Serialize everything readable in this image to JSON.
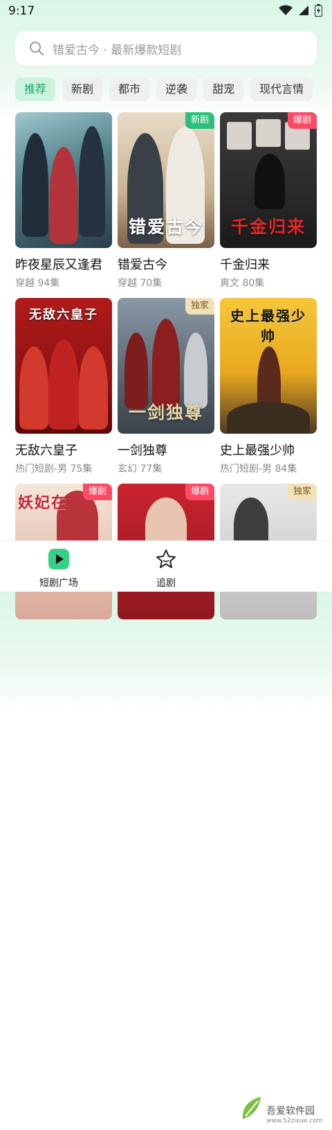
{
  "status": {
    "time": "9:17"
  },
  "search": {
    "placeholder": "错爱古今 · 最新爆款短剧"
  },
  "tags": [
    "推荐",
    "新剧",
    "都市",
    "逆袭",
    "甜宠",
    "现代言情"
  ],
  "cards": [
    {
      "title": "昨夜星辰又逢君",
      "sub": "穿越 94集",
      "badge": "",
      "poster_text": ""
    },
    {
      "title": "错爱古今",
      "sub": "穿越 70集",
      "badge": "新剧",
      "poster_text": "错爱古今"
    },
    {
      "title": "千金归来",
      "sub": "爽文 80集",
      "badge": "爆剧",
      "poster_text": "千金归来"
    },
    {
      "title": "无敌六皇子",
      "sub": "热门短剧-男 75集",
      "badge": "",
      "poster_text": "无敌六皇子"
    },
    {
      "title": "一剑独尊",
      "sub": "玄幻 77集",
      "badge": "独家",
      "poster_text": "一剑独尊"
    },
    {
      "title": "史上最强少帅",
      "sub": "热门短剧-男 84集",
      "badge": "",
      "poster_text": "史上最强少帅"
    },
    {
      "title": "",
      "sub": "",
      "badge": "爆剧",
      "poster_text": "妖妃在"
    },
    {
      "title": "",
      "sub": "",
      "badge": "爆剧",
      "poster_text": ""
    },
    {
      "title": "",
      "sub": "",
      "badge": "独家",
      "poster_text": ""
    }
  ],
  "nav": {
    "home_label": "短剧广场",
    "follow_label": "追剧"
  },
  "watermark": {
    "brand": "吾爱软件园",
    "url": "www.52zixue.com"
  },
  "colors": {
    "accent": "#16a866",
    "badge_new": "#2fbf7a",
    "badge_hot": "#ff4a66",
    "badge_exclusive": "#f3e2b8"
  }
}
